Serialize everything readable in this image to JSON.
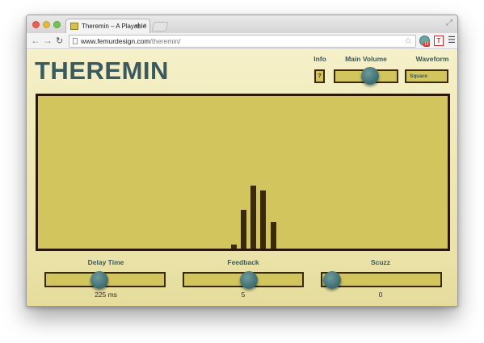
{
  "browser": {
    "tab_title": "Theremin – A Playable",
    "tab_audio_icon": "speaker-icon",
    "tab_close": "×",
    "url_domain": "www.femurdesign.com",
    "url_path": "/theremin/",
    "ext_badge": "19",
    "ext2_label": "T"
  },
  "app": {
    "title": "THEREMIN",
    "info_label": "Info",
    "info_button": "?",
    "volume_label": "Main Volume",
    "volume_level": 0.55,
    "waveform_label": "Waveform",
    "waveform_value": "Square"
  },
  "visualizer": {
    "bar_color": "#3a2a08",
    "background": "#d2c55e",
    "bars": [
      0.02,
      0.25,
      0.4,
      0.37,
      0.17
    ]
  },
  "effects": {
    "delay_label": "Delay Time",
    "delay_value": "225 ms",
    "delay_level": 0.45,
    "feedback_label": "Feedback",
    "feedback_value": "5",
    "feedback_level": 0.5,
    "scuzz_label": "Scuzz",
    "scuzz_value": "0",
    "scuzz_level": 0.0
  },
  "colors": {
    "accent": "#3b5a5e",
    "panel": "#d2c55e",
    "outline": "#3a2a08"
  }
}
